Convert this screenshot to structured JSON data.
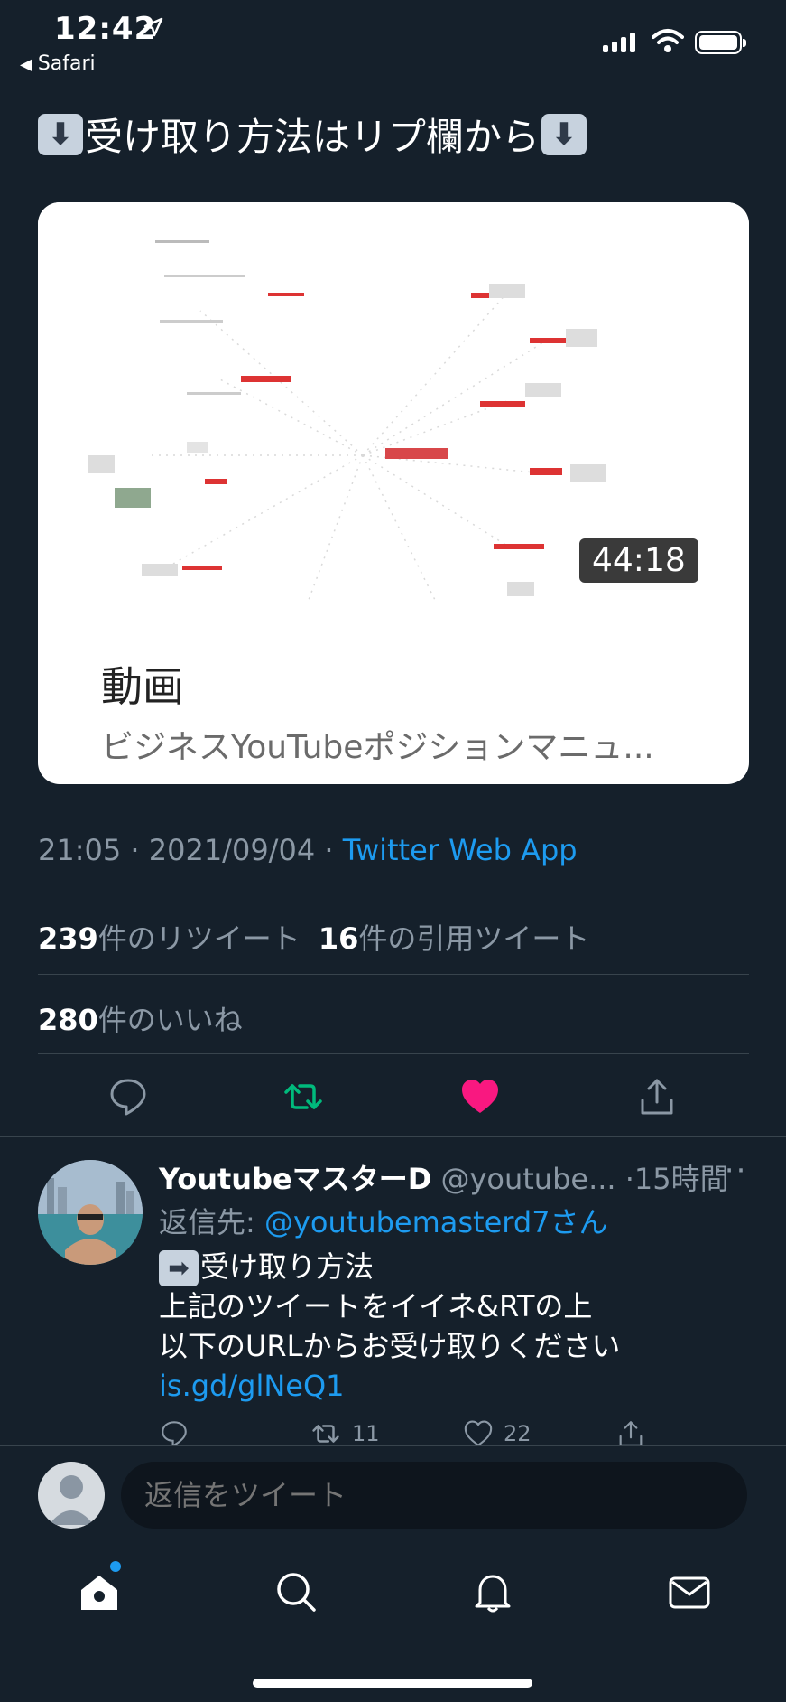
{
  "status_bar": {
    "time": "12:42",
    "back_app": "Safari"
  },
  "tweet": {
    "headline": "受け取り方法はリプ欄から",
    "card": {
      "duration": "44:18",
      "title": "動画",
      "subtitle": "ビジネスYouTubeポジションマニュ..."
    },
    "meta_time": "21:05 · 2021/09/04 · ",
    "meta_source": "Twitter Web App",
    "retweets_count": "239",
    "retweets_label": "件のリツイート",
    "quotes_count": "16",
    "quotes_label": "件の引用ツイート",
    "likes_count": "280",
    "likes_label": "件のいいね"
  },
  "reply": {
    "name": "YoutubeマスターD",
    "handle": "@youtube...",
    "time": "·15時間",
    "reply_to_prefix": "返信先: ",
    "reply_to_handle": "@youtubemasterd7さん",
    "line1": "受け取り方法",
    "line2": "上記のツイートをイイネ&RTの上",
    "line3": "以下のURLからお受け取りください",
    "link": "is.gd/glNeQ1",
    "retweet_count": "11",
    "like_count": "22"
  },
  "compose": {
    "placeholder": "返信をツイート"
  },
  "colors": {
    "background": "#15202b",
    "accent": "#1d9bf0",
    "retweet_green": "#00ba7c",
    "like_red": "#f91880",
    "muted": "#8b98a5"
  }
}
